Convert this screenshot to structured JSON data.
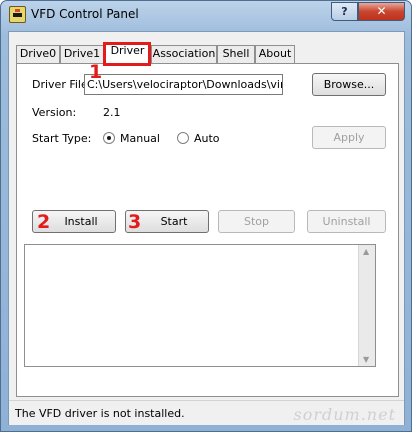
{
  "window": {
    "title": "VFD Control Panel"
  },
  "caption_buttons": {
    "help": "?",
    "close": "✕"
  },
  "tabs": [
    {
      "label": "Drive0"
    },
    {
      "label": "Drive1"
    },
    {
      "label": "Driver",
      "active": true
    },
    {
      "label": "Association"
    },
    {
      "label": "Shell"
    },
    {
      "label": "About"
    }
  ],
  "annotations": {
    "step1": "1",
    "step2": "2",
    "step3": "3",
    "accent": "#e21b1b"
  },
  "driver": {
    "file_label": "Driver File:",
    "file_value": "C:\\Users\\velociraptor\\Downloads\\virtual\\",
    "browse_label": "Browse...",
    "version_label": "Version:",
    "version_value": "2.1",
    "start_type_label": "Start Type:",
    "manual_label": "Manual",
    "auto_label": "Auto",
    "start_type_selected": "Manual",
    "apply_label": "Apply"
  },
  "actions": {
    "install_label": "Install",
    "start_label": "Start",
    "stop_label": "Stop",
    "uninstall_label": "Uninstall"
  },
  "status": {
    "text": "The VFD driver is not installed."
  },
  "watermark": "sordum.net"
}
